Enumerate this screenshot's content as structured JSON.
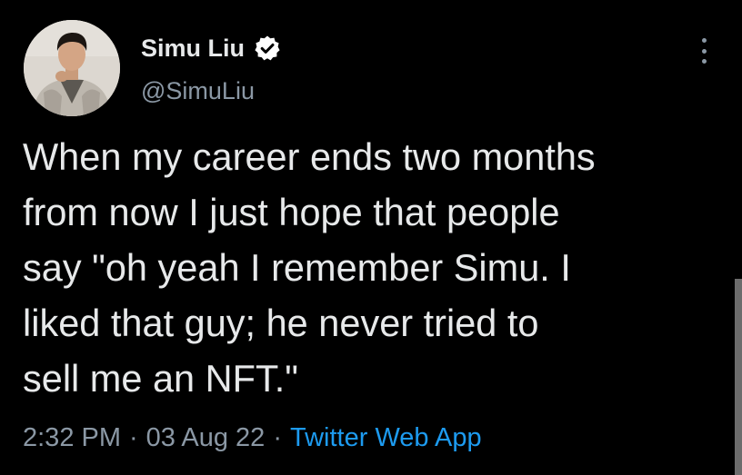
{
  "tweet": {
    "author": {
      "display_name": "Simu Liu",
      "handle": "@SimuLiu",
      "verified": true,
      "avatar_icon": "avatar-photo"
    },
    "more_icon": "more-vertical-icon",
    "text_lines": [
      "When my career ends two months",
      "from now I just hope that people",
      "say \"oh yeah I remember Simu. I",
      "liked that guy; he never tried to",
      "sell me an NFT.\""
    ],
    "time": "2:32 PM",
    "separator": "·",
    "date": "03 Aug 22",
    "source": "Twitter Web App"
  },
  "colors": {
    "background": "#000000",
    "text": "#e7e9ea",
    "secondary": "#8b98a5",
    "accent": "#1d9bf0"
  }
}
